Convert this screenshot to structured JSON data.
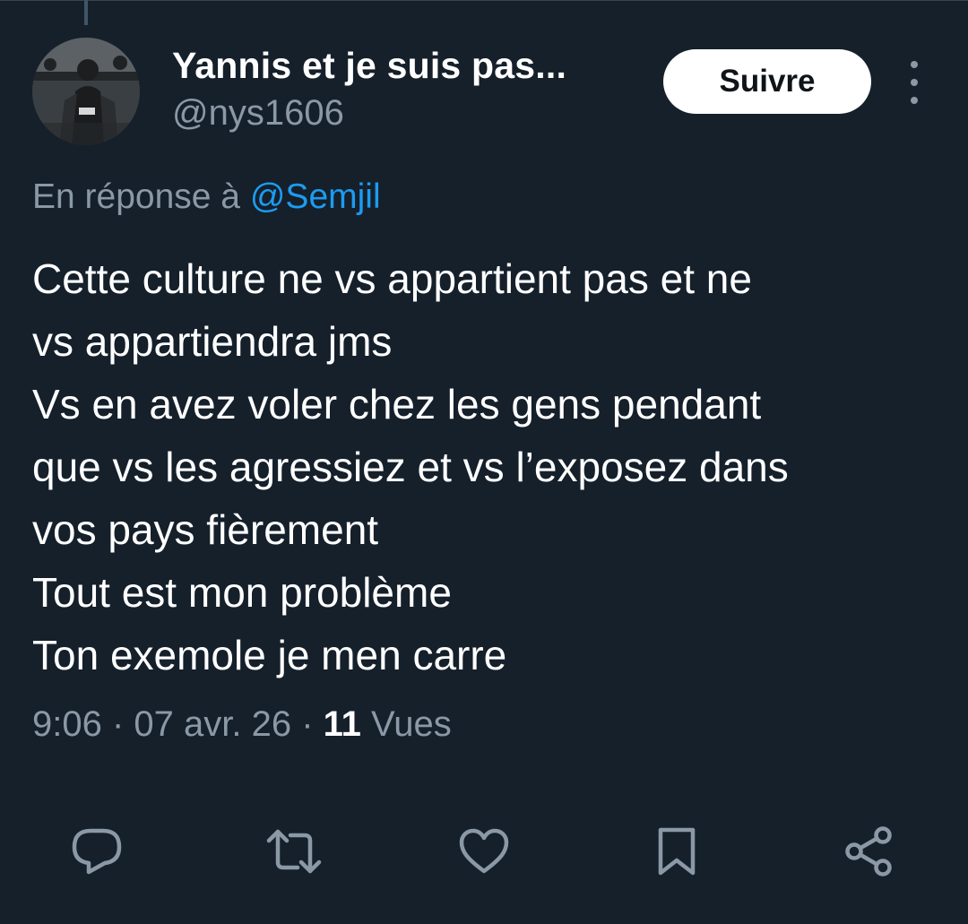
{
  "author": {
    "display_name": "Yannis et je suis pas...",
    "handle": "@nys1606"
  },
  "follow_button": {
    "label": "Suivre"
  },
  "more_button": {
    "icon": "more-vertical-icon"
  },
  "reply_context": {
    "prefix": "En réponse à ",
    "mention": "@Semjil"
  },
  "tweet": {
    "lines": [
      "Cette culture ne vs appartient pas et ne",
      "vs appartiendra jms",
      "Vs en avez voler chez les gens pendant",
      "que vs les agressiez et vs l’exposez dans",
      "vos pays fièrement",
      "Tout est mon problème",
      "Ton exemole je men carre"
    ]
  },
  "meta": {
    "time": "9:06",
    "separator": " · ",
    "date": "07 avr. 26",
    "views_count": "11",
    "views_label": " Vues"
  },
  "actions": [
    {
      "name": "reply",
      "icon": "reply-icon"
    },
    {
      "name": "retweet",
      "icon": "retweet-icon"
    },
    {
      "name": "like",
      "icon": "heart-icon"
    },
    {
      "name": "bookmark",
      "icon": "bookmark-icon"
    },
    {
      "name": "share",
      "icon": "share-icon"
    }
  ],
  "colors": {
    "background": "#15202b",
    "primary_text": "#ffffff",
    "secondary_text": "#8b98a5",
    "link": "#1d9bf0",
    "button_bg": "#ffffff",
    "button_text": "#0f1419"
  }
}
